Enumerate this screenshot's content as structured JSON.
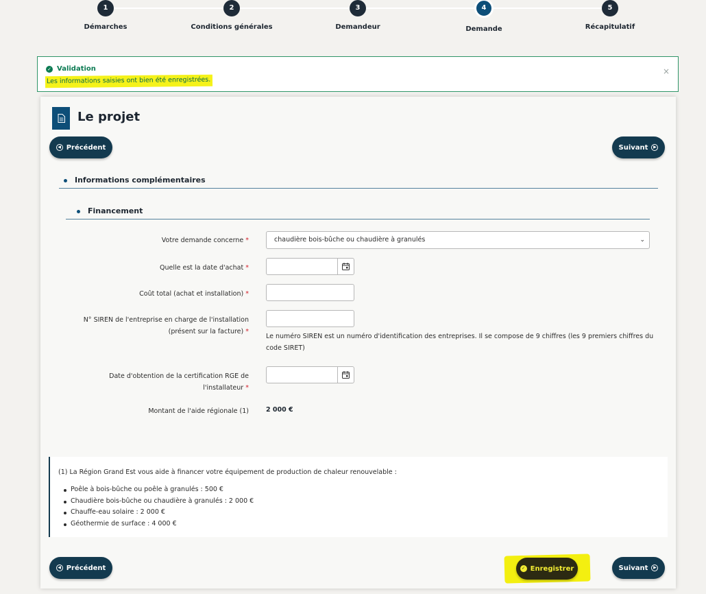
{
  "stepper": {
    "steps": [
      {
        "number": "1",
        "label": "Démarches"
      },
      {
        "number": "2",
        "label": "Conditions générales"
      },
      {
        "number": "3",
        "label": "Demandeur"
      },
      {
        "number": "4",
        "label": "Demande"
      },
      {
        "number": "5",
        "label": "Récapitulatif"
      }
    ],
    "active_step": 4
  },
  "alert": {
    "title": "Validation",
    "message": "Les informations saisies ont bien été enregistrées.",
    "close": "×",
    "color": "#0b7a52",
    "highlight_color": "#f5f21a"
  },
  "card": {
    "title": "Le projet",
    "icon": "document-icon"
  },
  "nav": {
    "prev_label": "Précédent",
    "next_label": "Suivant",
    "save_label": "Enregistrer"
  },
  "sections": {
    "info": "Informations complémentaires",
    "funding": "Financement"
  },
  "form": {
    "required_mark": "*",
    "demand_label": "Votre demande concerne",
    "demand_value": "chaudière bois-bûche ou chaudière à granulés",
    "purchase_date_label": "Quelle est la date d'achat",
    "purchase_date_value": "",
    "total_cost_label": "Coût total (achat et installation)",
    "total_cost_value": "",
    "siren_label_line1": "N° SIREN de l'entreprise en charge de l'installation",
    "siren_label_line2": "(présent sur la facture)",
    "siren_value": "",
    "siren_help": "Le numéro SIREN est un numéro d'identification des entreprises. Il se compose de 9 chiffres (les 9 premiers chiffres du code SIRET)",
    "rge_label_line1": "Date d'obtention de la certification RGE de",
    "rge_label_line2": "l'installateur",
    "rge_value": "",
    "aid_label": "Montant de l'aide régionale (1)",
    "aid_value": "2 000 €"
  },
  "note": {
    "heading": "(1) La Région Grand Est vous aide à financer votre équipement de production de chaleur renouvelable :",
    "items": [
      "Poêle à bois-bûche ou poêle à granulés : 500 €",
      "Chaudière bois-bûche ou chaudière à granulés : 2 000 €",
      "Chauffe-eau solaire : 2 000 €",
      "Géothermie de surface : 4 000 €"
    ]
  },
  "colors": {
    "primary": "#0d4e78",
    "button": "#133a4f",
    "required": "#d3212c"
  }
}
